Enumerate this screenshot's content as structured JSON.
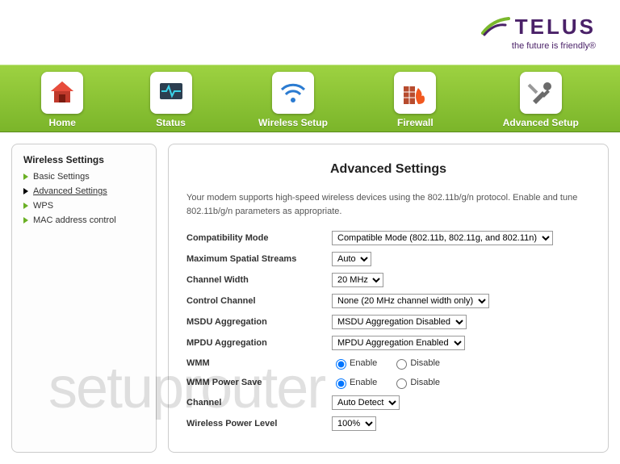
{
  "brand": {
    "name": "TELUS",
    "tagline": "the future is friendly®"
  },
  "nav": [
    {
      "id": "home",
      "label": "Home"
    },
    {
      "id": "status",
      "label": "Status"
    },
    {
      "id": "wireless",
      "label": "Wireless Setup"
    },
    {
      "id": "firewall",
      "label": "Firewall"
    },
    {
      "id": "advanced",
      "label": "Advanced Setup"
    }
  ],
  "sidebar": {
    "title": "Wireless Settings",
    "items": [
      {
        "label": "Basic Settings",
        "active": false
      },
      {
        "label": "Advanced Settings",
        "active": true
      },
      {
        "label": "WPS",
        "active": false
      },
      {
        "label": "MAC address control",
        "active": false
      }
    ]
  },
  "page": {
    "title": "Advanced Settings",
    "description": "Your modem supports high-speed wireless devices using the 802.11b/g/n protocol. Enable and tune 802.11b/g/n parameters as appropriate."
  },
  "fields": {
    "compat": {
      "label": "Compatibility Mode",
      "value": "Compatible Mode (802.11b, 802.11g, and 802.11n)"
    },
    "streams": {
      "label": "Maximum Spatial Streams",
      "value": "Auto"
    },
    "cwidth": {
      "label": "Channel Width",
      "value": "20 MHz"
    },
    "cchannel": {
      "label": "Control Channel",
      "value": "None (20 MHz channel width only)"
    },
    "msdu": {
      "label": "MSDU Aggregation",
      "value": "MSDU Aggregation Disabled"
    },
    "mpdu": {
      "label": "MPDU Aggregation",
      "value": "MPDU Aggregation Enabled"
    },
    "wmm": {
      "label": "WMM",
      "enable": "Enable",
      "disable": "Disable",
      "value": "enable"
    },
    "wmmps": {
      "label": "WMM Power Save",
      "enable": "Enable",
      "disable": "Disable",
      "value": "enable"
    },
    "channel": {
      "label": "Channel",
      "value": "Auto Detect"
    },
    "power": {
      "label": "Wireless Power Level",
      "value": "100%"
    }
  },
  "watermark": "setuprouter"
}
